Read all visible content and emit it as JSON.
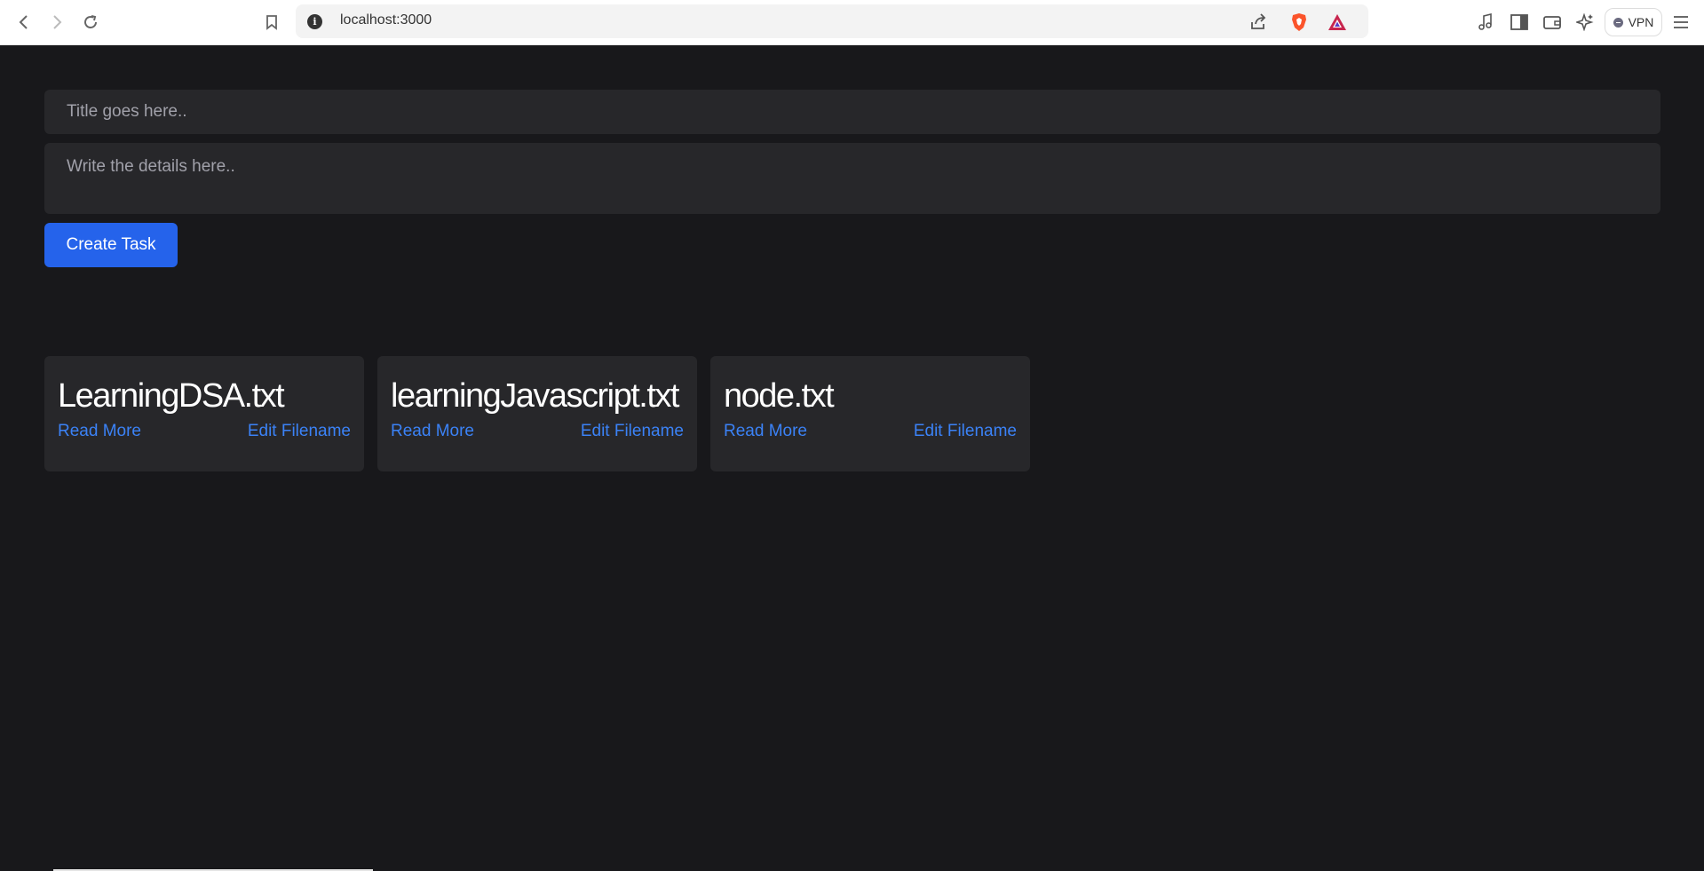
{
  "browser": {
    "url": "localhost:3000",
    "vpn_label": "VPN",
    "icons": [
      "back-icon",
      "forward-icon",
      "reload-icon",
      "bookmark-icon",
      "site-info-icon",
      "share-icon",
      "brave-shields-icon",
      "brave-rewards-icon",
      "media-icon",
      "sidebar-icon",
      "wallet-icon",
      "leo-ai-icon",
      "vpn-icon",
      "menu-icon"
    ]
  },
  "form": {
    "title_placeholder": "Title goes here..",
    "details_placeholder": "Write the details here..",
    "create_label": "Create Task"
  },
  "tasks": [
    {
      "title": "LearningDSA.txt",
      "read_more": "Read More",
      "edit": "Edit Filename"
    },
    {
      "title": "learningJavascript.txt",
      "read_more": "Read More",
      "edit": "Edit Filename"
    },
    {
      "title": "node.txt",
      "read_more": "Read More",
      "edit": "Edit Filename"
    }
  ],
  "colors": {
    "background": "#18181b",
    "surface": "#27272a",
    "accent": "#2563eb",
    "link": "#3b82f6"
  }
}
